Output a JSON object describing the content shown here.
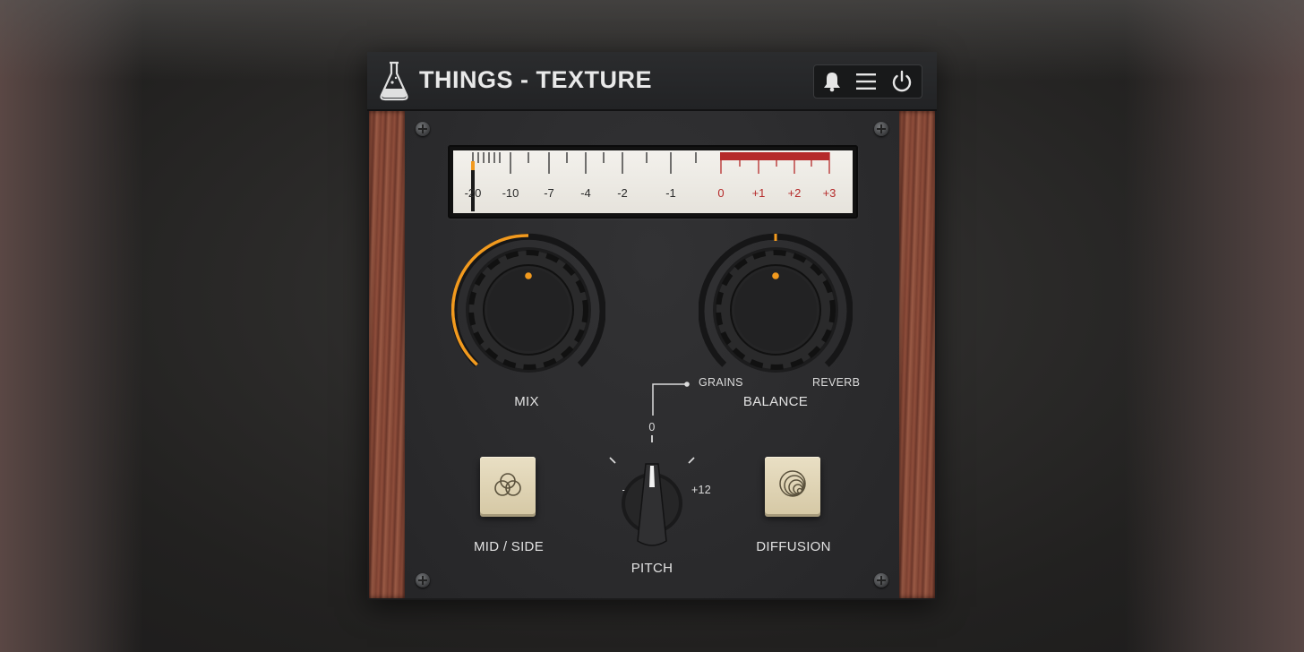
{
  "window": {
    "title": "THINGS - TEXTURE",
    "buttons": [
      "bell-icon",
      "menu-icon",
      "power-icon"
    ]
  },
  "meter": {
    "scale_labels": [
      "-20",
      "-10",
      "-7",
      "-4",
      "-2",
      "-1",
      "0",
      "+1",
      "+2",
      "+3"
    ],
    "needle_position": "-20",
    "colors": {
      "normal": "#2a2a2a",
      "red_zone": "#b52a2a"
    }
  },
  "controls": {
    "mix": {
      "label": "MIX",
      "level": 0.5
    },
    "balance": {
      "label": "BALANCE",
      "left_label": "GRAINS",
      "right_label": "REVERB",
      "level": 0.5
    },
    "pitch": {
      "label": "PITCH",
      "min_label": "-12",
      "center_label": "0",
      "max_label": "+12"
    },
    "mid_side": {
      "label": "MID / SIDE"
    },
    "diffusion": {
      "label": "DIFFUSION"
    }
  },
  "accent_color": "#f29a1e"
}
